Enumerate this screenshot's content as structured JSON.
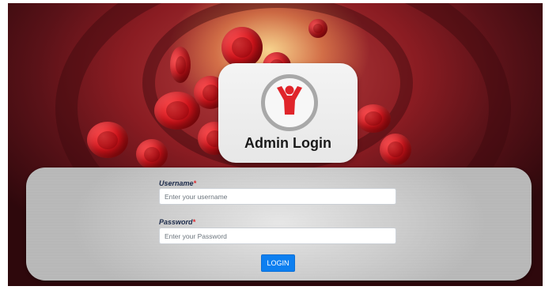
{
  "login_card": {
    "title": "Admin Login",
    "logo_icon": "person-arms-raised-icon",
    "logo_color": "#e0242a"
  },
  "form": {
    "username": {
      "label": "Username",
      "required_mark": "*",
      "placeholder": "Enter your username",
      "value": ""
    },
    "password": {
      "label": "Password",
      "required_mark": "*",
      "placeholder": "Enter your Password",
      "value": ""
    },
    "submit_label": "LOGIN"
  },
  "colors": {
    "accent": "#0d7ff0",
    "required": "#e0242a",
    "background_theme": "#a0141c"
  }
}
